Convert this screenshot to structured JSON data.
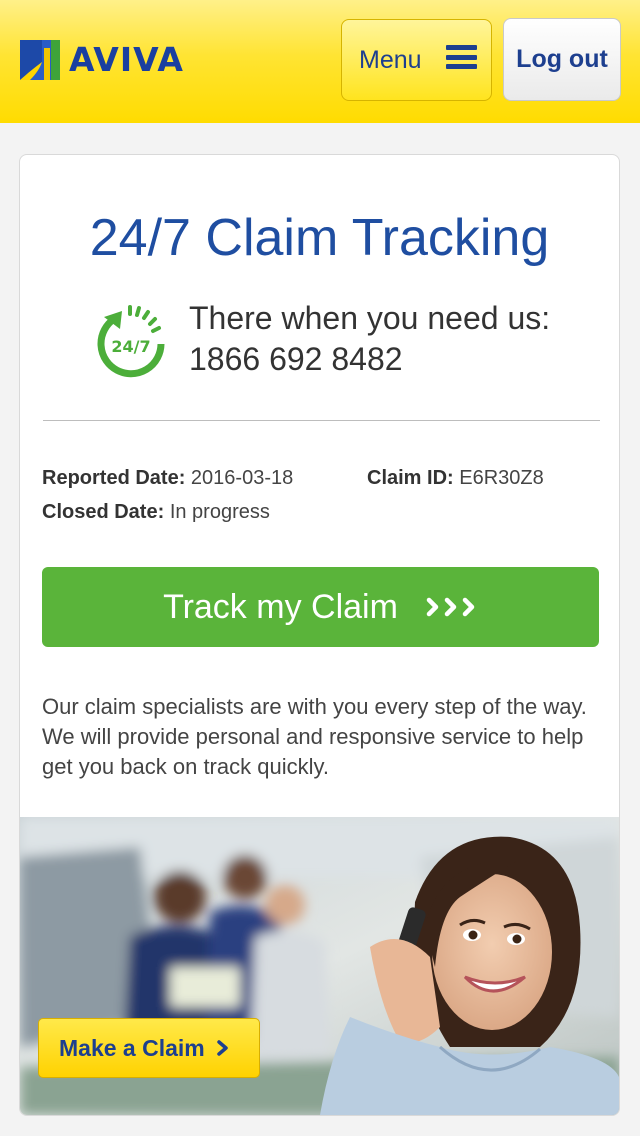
{
  "header": {
    "logo_text": "AVIVA",
    "menu_label": "Menu",
    "logout_label": "Log out"
  },
  "card": {
    "title": "24/7 Claim Tracking",
    "clock_badge": "24/7",
    "tagline_line1": "There when you need us:",
    "tagline_line2": "1866 692 8482",
    "reported_label": "Reported Date:",
    "reported_value": "2016-03-18",
    "claim_id_label": "Claim ID:",
    "claim_id_value": "E6R30Z8",
    "closed_label": "Closed Date:",
    "closed_value": "In progress",
    "track_button": "Track my Claim",
    "description": "Our claim specialists are with you every step of the way. We will provide personal and responsive service to help get you back on track quickly.",
    "make_claim_button": "Make a Claim"
  },
  "colors": {
    "brand_blue": "#1f4ea1",
    "brand_yellow": "#ffdc00",
    "action_green": "#5ab43a"
  },
  "icons": {
    "hamburger": "menu-icon",
    "clock": "clock-24-7-icon",
    "track_arrows": "triple-chevron-right-icon",
    "make_claim_arrow": "chevron-right-icon"
  }
}
